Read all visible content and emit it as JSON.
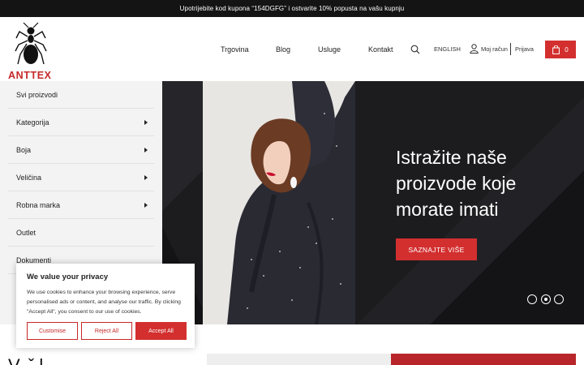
{
  "topbar": {
    "promo": "Upotrijebite kod kupona “154DGFG” i ostvarite 10% popusta na vašu kupnju"
  },
  "logo": {
    "text": "ANTTEX"
  },
  "nav": {
    "items": [
      "Trgovina",
      "Blog",
      "Usluge",
      "Kontakt"
    ],
    "language": "ENGLISH",
    "account": "Moj račun",
    "login": "Prijava",
    "cart_count": "0"
  },
  "sidebar": {
    "items": [
      {
        "label": "Svi proizvodi"
      },
      {
        "label": "Kategorija"
      },
      {
        "label": "Boja"
      },
      {
        "label": "Veličina"
      },
      {
        "label": "Robna marka"
      },
      {
        "label": "Outlet"
      },
      {
        "label": "Dokumenti"
      }
    ]
  },
  "hero": {
    "title": "Istražite naše proizvode koje morate imati",
    "button": "SAZNAJTE VIŠE",
    "slides": 3,
    "active_slide": 2
  },
  "cookie": {
    "title": "We value your privacy",
    "text": "We use cookies to enhance your browsing experience, serve personalised ads or content, and analyse our traffic. By clicking \"Accept All\", you consent to our use of cookies.",
    "customise": "Customise",
    "reject": "Reject All",
    "accept": "Accept All"
  },
  "below": {
    "title_partial": "V.   ˇ   l"
  },
  "colors": {
    "accent": "#d32f2f",
    "dark": "#141414",
    "hero_bg": "#1c1c1f"
  }
}
